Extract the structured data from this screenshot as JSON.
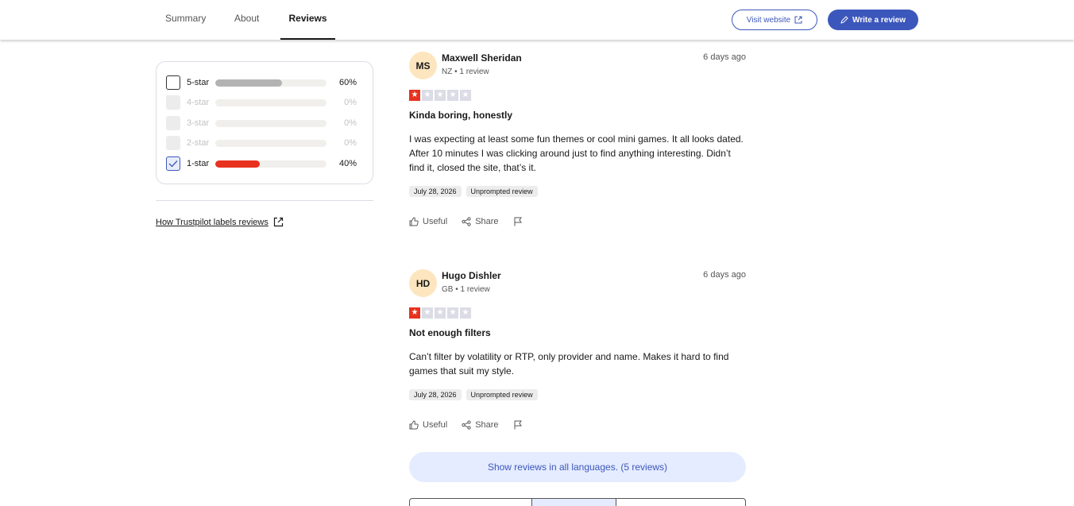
{
  "nav": {
    "tabs": [
      {
        "label": "Summary"
      },
      {
        "label": "About"
      },
      {
        "label": "Reviews"
      }
    ],
    "visit_label": "Visit website",
    "write_label": "Write a review"
  },
  "filters": {
    "rows": [
      {
        "label": "5-star",
        "percent": "60%",
        "value": 60,
        "state": "unchecked",
        "color": "#b3b3b3"
      },
      {
        "label": "4-star",
        "percent": "0%",
        "value": 0,
        "state": "disabled",
        "color": "#73cf11"
      },
      {
        "label": "3-star",
        "percent": "0%",
        "value": 0,
        "state": "disabled",
        "color": "#ffce00"
      },
      {
        "label": "2-star",
        "percent": "0%",
        "value": 0,
        "state": "disabled",
        "color": "#ff8622"
      },
      {
        "label": "1-star",
        "percent": "40%",
        "value": 40,
        "state": "checked",
        "color": "#e8321f"
      }
    ],
    "labels_link": "How Trustpilot labels reviews"
  },
  "reviews": [
    {
      "initials": "MS",
      "name": "Maxwell Sheridan",
      "meta": "NZ • 1 review",
      "posted": "6 days ago",
      "rating": 1,
      "title": "Kinda boring, honestly",
      "text": "I was expecting at least some fun themes or cool mini games. It all looks dated. After 10 minutes I was clicking around just to find anything interesting. Didn’t find it, closed the site, that’s it.",
      "date_tag": "July 28, 2026",
      "type_tag": "Unprompted review",
      "useful": "Useful",
      "share": "Share"
    },
    {
      "initials": "HD",
      "name": "Hugo Dishler",
      "meta": "GB • 1 review",
      "posted": "6 days ago",
      "rating": 1,
      "title": "Not enough filters",
      "text": "Can’t filter by volatility or RTP, only provider and name. Makes it hard to find games that suit my style.",
      "date_tag": "July 28, 2026",
      "type_tag": "Unprompted review",
      "useful": "Useful",
      "share": "Share"
    }
  ],
  "show_all_label": "Show reviews in all languages. (5 reviews)",
  "colors": {
    "accent": "#3c57bc",
    "star_red": "#e8321f",
    "avatar_bg": "#fde6bf"
  }
}
